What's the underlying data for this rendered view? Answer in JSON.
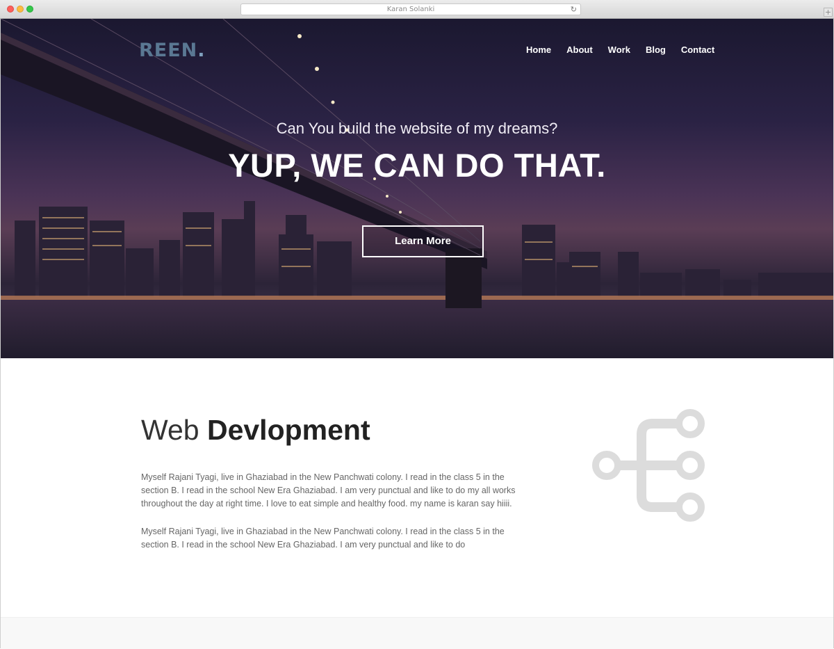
{
  "browser": {
    "url_title": "Karan Solanki",
    "reload_icon": "reload-icon",
    "new_tab_icon": "plus-icon"
  },
  "header": {
    "logo_text": "REEN",
    "logo_dot": ".",
    "nav": [
      {
        "label": "Home"
      },
      {
        "label": "About"
      },
      {
        "label": "Work"
      },
      {
        "label": "Blog"
      },
      {
        "label": "Contact"
      }
    ]
  },
  "hero": {
    "tagline": "Can You build the website of my dreams?",
    "headline": "YUP, WE CAN DO THAT.",
    "cta_label": "Learn More"
  },
  "section": {
    "title_light": "Web",
    "title_bold": "Devlopment",
    "paragraphs": [
      "Myself Rajani Tyagi, live in Ghaziabad in the New Panchwati colony. I read in the class 5 in the section B. I read in the school New Era Ghaziabad. I am very punctual and like to do my all works throughout the day at right time. I love to eat simple and healthy food. my name is karan say hiiii.",
      "Myself Rajani Tyagi, live in Ghaziabad in the New Panchwati colony. I read in the class 5 in the section B. I read in the school New Era Ghaziabad. I am very punctual and like to do"
    ],
    "icon": "sitemap-icon"
  },
  "colors": {
    "logo": "#5a7893",
    "icon_gray": "#dcdcdc",
    "text_dark": "#222222",
    "text_body": "#666666"
  }
}
